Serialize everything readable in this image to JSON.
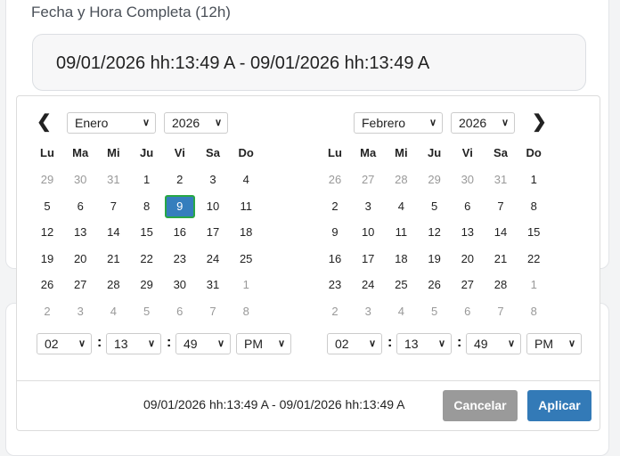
{
  "label": "Fecha y Hora Completa (12h)",
  "value": "09/01/2026 hh:13:49 A - 09/01/2026 hh:13:49 A",
  "day_names": [
    "Lu",
    "Ma",
    "Mi",
    "Ju",
    "Vi",
    "Sa",
    "Do"
  ],
  "left": {
    "month": "Enero",
    "year": "2026",
    "days": [
      [
        "29",
        "30",
        "31",
        "1",
        "2",
        "3",
        "4"
      ],
      [
        "5",
        "6",
        "7",
        "8",
        "9",
        "10",
        "11"
      ],
      [
        "12",
        "13",
        "14",
        "15",
        "16",
        "17",
        "18"
      ],
      [
        "19",
        "20",
        "21",
        "22",
        "23",
        "24",
        "25"
      ],
      [
        "26",
        "27",
        "28",
        "29",
        "30",
        "31",
        "1"
      ],
      [
        "2",
        "3",
        "4",
        "5",
        "6",
        "7",
        "8"
      ]
    ],
    "off": [
      [
        1,
        1,
        1,
        0,
        0,
        0,
        0
      ],
      [
        0,
        0,
        0,
        0,
        0,
        0,
        0
      ],
      [
        0,
        0,
        0,
        0,
        0,
        0,
        0
      ],
      [
        0,
        0,
        0,
        0,
        0,
        0,
        0
      ],
      [
        0,
        0,
        0,
        0,
        0,
        0,
        1
      ],
      [
        1,
        1,
        1,
        1,
        1,
        1,
        1
      ]
    ],
    "selected": [
      1,
      4
    ],
    "time": {
      "hour": "02",
      "minute": "13",
      "second": "49",
      "ampm": "PM"
    }
  },
  "right": {
    "month": "Febrero",
    "year": "2026",
    "days": [
      [
        "26",
        "27",
        "28",
        "29",
        "30",
        "31",
        "1"
      ],
      [
        "2",
        "3",
        "4",
        "5",
        "6",
        "7",
        "8"
      ],
      [
        "9",
        "10",
        "11",
        "12",
        "13",
        "14",
        "15"
      ],
      [
        "16",
        "17",
        "18",
        "19",
        "20",
        "21",
        "22"
      ],
      [
        "23",
        "24",
        "25",
        "26",
        "27",
        "28",
        "1"
      ],
      [
        "2",
        "3",
        "4",
        "5",
        "6",
        "7",
        "8"
      ]
    ],
    "off": [
      [
        1,
        1,
        1,
        1,
        1,
        1,
        0
      ],
      [
        0,
        0,
        0,
        0,
        0,
        0,
        0
      ],
      [
        0,
        0,
        0,
        0,
        0,
        0,
        0
      ],
      [
        0,
        0,
        0,
        0,
        0,
        0,
        0
      ],
      [
        0,
        0,
        0,
        0,
        0,
        0,
        1
      ],
      [
        1,
        1,
        1,
        1,
        1,
        1,
        1
      ]
    ],
    "time": {
      "hour": "02",
      "minute": "13",
      "second": "49",
      "ampm": "PM"
    }
  },
  "colon": ":",
  "footer": {
    "summary": "09/01/2026 hh:13:49 A - 09/01/2026 hh:13:49 A",
    "cancel": "Cancelar",
    "apply": "Aplicar"
  },
  "icons": {
    "prev": "‹",
    "next": "›",
    "chev": "⌄"
  }
}
